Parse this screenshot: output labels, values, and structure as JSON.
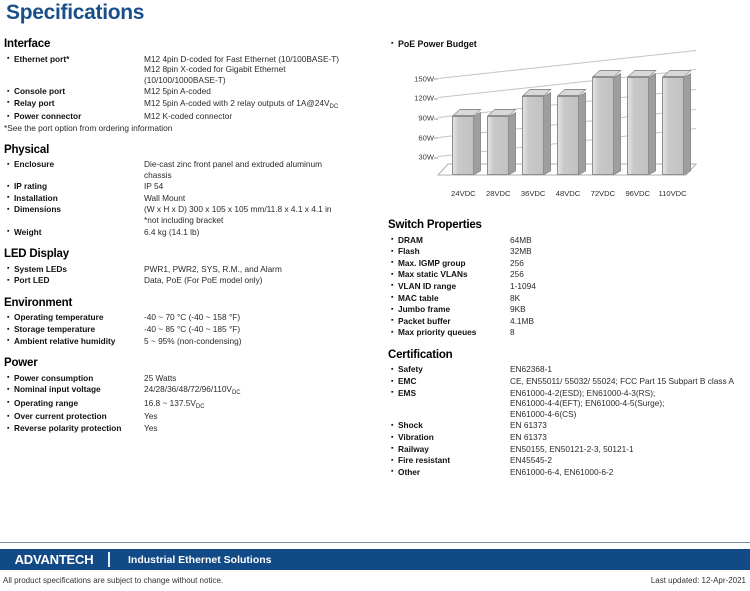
{
  "title": "Specifications",
  "left_sections": [
    {
      "title": "Interface",
      "rows": [
        {
          "label": "Ethernet port*",
          "value": "M12 4pin D-coded for Fast Ethernet (10/100BASE-T)\nM12 8pin X-coded for Gigabit Ethernet\n(10/100/1000BASE-T)"
        },
        {
          "label": "Console port",
          "value": "M12 5pin A-coded"
        },
        {
          "label": "Relay port",
          "value": "M12 5pin A-coded with 2 relay outputs of 1A@24VDC",
          "value_sub": "DC",
          "value_main": "M12 5pin A-coded with 2 relay outputs of 1A@24V"
        },
        {
          "label": "Power connector",
          "value": "M12 K-coded connector"
        }
      ],
      "footnote": "*See the port option from ordering information"
    },
    {
      "title": "Physical",
      "rows": [
        {
          "label": "Enclosure",
          "value": "Die-cast zinc front panel and extruded aluminum\nchassis"
        },
        {
          "label": "IP rating",
          "value": "IP 54"
        },
        {
          "label": "Installation",
          "value": "Wall Mount"
        },
        {
          "label": "Dimensions",
          "value": "(W x H x D) 300 x 105 x 105 mm/11.8 x 4.1 x 4.1 in\n*not including bracket"
        },
        {
          "label": "Weight",
          "value": "6.4 kg (14.1 lb)"
        }
      ]
    },
    {
      "title": "LED Display",
      "rows": [
        {
          "label": "System LEDs",
          "value": "PWR1, PWR2, SYS, R.M., and Alarm"
        },
        {
          "label": "Port LED",
          "value": "Data, PoE (For PoE model only)"
        }
      ]
    },
    {
      "title": "Environment",
      "rows": [
        {
          "label": "Operating temperature",
          "value": "-40 ~ 70 °C (-40 ~ 158 °F)"
        },
        {
          "label": "Storage temperature",
          "value": "-40 ~ 85 °C (-40 ~ 185 °F)"
        },
        {
          "label": "Ambient relative humidity",
          "value": "5 ~ 95% (non-condensing)"
        }
      ]
    },
    {
      "title": "Power",
      "rows": [
        {
          "label": "Power consumption",
          "value": "25 Watts"
        },
        {
          "label": "Nominal input voltage",
          "value": "24/28/36/48/72/96/110VDC",
          "value_main": "24/28/36/48/72/96/110V",
          "value_sub": "DC"
        },
        {
          "label": "Operating range",
          "value": "16.8 ~ 137.5VDC",
          "value_main": "16.8 ~ 137.5V",
          "value_sub": "DC"
        },
        {
          "label": "Over current protection",
          "value": "Yes"
        },
        {
          "label": "Reverse polarity protection",
          "value": "Yes"
        }
      ]
    }
  ],
  "chart_heading": "PoE Power Budget",
  "chart_data": {
    "type": "bar",
    "title": "PoE Power Budget",
    "categories": [
      "24VDC",
      "28VDC",
      "36VDC",
      "48VDC",
      "72VDC",
      "96VDC",
      "110VDC"
    ],
    "values": [
      90,
      90,
      120,
      120,
      150,
      150,
      150
    ],
    "ytick_labels": [
      "150W",
      "120W",
      "90W",
      "60W",
      "30W"
    ],
    "ytick_values": [
      150,
      120,
      90,
      60,
      30
    ],
    "ylim": [
      0,
      180
    ],
    "xlabel": "",
    "ylabel": "",
    "grid": true,
    "legend": "none",
    "style": "3d-column"
  },
  "right_sections": [
    {
      "title": "Switch Properties",
      "rows": [
        {
          "label": "DRAM",
          "value": "64MB"
        },
        {
          "label": "Flash",
          "value": "32MB"
        },
        {
          "label": "Max. IGMP group",
          "value": "256"
        },
        {
          "label": "Max static VLANs",
          "value": "256"
        },
        {
          "label": "VLAN ID range",
          "value": "1-1094"
        },
        {
          "label": "MAC table",
          "value": "8K"
        },
        {
          "label": "Jumbo frame",
          "value": "9KB"
        },
        {
          "label": "Packet buffer",
          "value": "4.1MB"
        },
        {
          "label": "Max priority queues",
          "value": "8"
        }
      ]
    },
    {
      "title": "Certification",
      "rows": [
        {
          "label": "Safety",
          "value": "EN62368-1"
        },
        {
          "label": "EMC",
          "value": "CE, EN55011/ 55032/ 55024; FCC Part 15 Subpart B class A"
        },
        {
          "label": "EMS",
          "value": "EN61000-4-2(ESD); EN61000-4-3(RS);\nEN61000-4-4(EFT); EN61000-4-5(Surge);\nEN61000-4-6(CS)"
        },
        {
          "label": "Shock",
          "value": "EN 61373"
        },
        {
          "label": "Vibration",
          "value": "EN 61373"
        },
        {
          "label": "Railway",
          "value": "EN50155, EN50121-2-3, 50121-1"
        },
        {
          "label": "Fire resistant",
          "value": "EN45545-2"
        },
        {
          "label": "Other",
          "value": "EN61000-6-4, EN61000-6-2"
        }
      ]
    }
  ],
  "footer": {
    "brand": "ADVANTECH",
    "tagline": "Industrial Ethernet Solutions",
    "disclaimer": "All product specifications are subject to change without notice.",
    "last_updated": "Last updated: 12-Apr-2021"
  },
  "colors": {
    "brand_blue": "#114a86",
    "title_blue": "#1b4f8a",
    "bar_fill": "#c9c9c9",
    "grid": "#c4c4c4"
  }
}
